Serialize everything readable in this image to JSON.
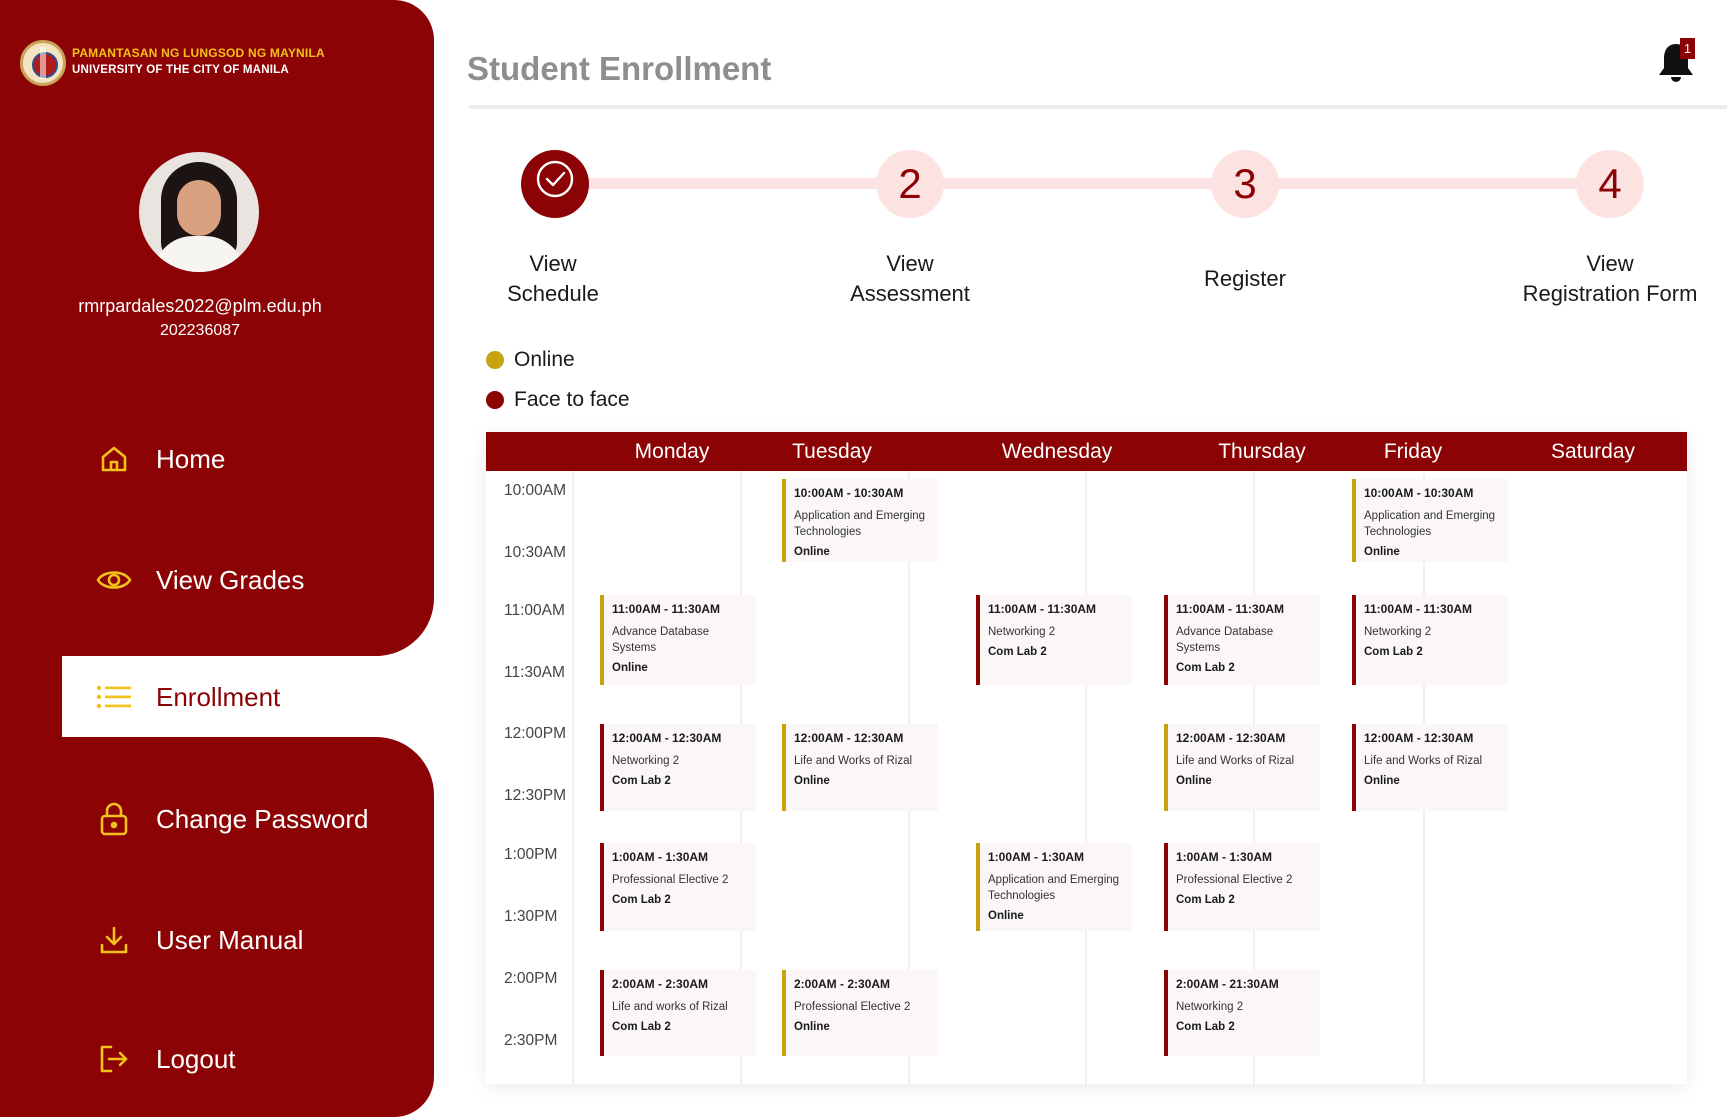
{
  "sidebar": {
    "university_line1": "PAMANTASAN NG LUNGSOD NG MAYNILA",
    "university_line2": "UNIVERSITY OF THE CITY OF MANILA",
    "email": "rmrpardales2022@plm.edu.ph",
    "student_id": "202236087",
    "nav": [
      {
        "label": "Home",
        "icon": "home-icon"
      },
      {
        "label": "View Grades",
        "icon": "eye-icon"
      },
      {
        "label": "Enrollment",
        "icon": "list-icon",
        "active": true
      },
      {
        "label": "Change Password",
        "icon": "lock-icon"
      },
      {
        "label": "User Manual",
        "icon": "download-icon"
      },
      {
        "label": "Logout",
        "icon": "logout-icon"
      }
    ]
  },
  "header": {
    "title": "Student Enrollment",
    "notification_count": "1"
  },
  "stepper": [
    {
      "number": "",
      "label_line1": "View",
      "label_line2": "Schedule",
      "done": true
    },
    {
      "number": "2",
      "label_line1": "View",
      "label_line2": "Assessment"
    },
    {
      "number": "3",
      "label_line1": "Register",
      "label_line2": ""
    },
    {
      "number": "4",
      "label_line1": "View",
      "label_line2": "Registration Form"
    }
  ],
  "legend": [
    {
      "label": "Online",
      "color": "#c9a30f"
    },
    {
      "label": "Face to face",
      "color": "#8b0304"
    }
  ],
  "schedule": {
    "days": [
      "Monday",
      "Tuesday",
      "Wednesday",
      "Thursday",
      "Friday",
      "Saturday"
    ],
    "times": [
      "10:00AM",
      "10:30AM",
      "11:00AM",
      "11:30AM",
      "12:00PM",
      "12:30PM",
      "1:00PM",
      "1:30PM",
      "2:00PM",
      "2:30PM"
    ],
    "classes": [
      {
        "day": 1,
        "time": "10:00AM - 10:30AM",
        "subject": "Application and Emerging Technologies",
        "location": "Online",
        "mode": "online"
      },
      {
        "day": 4,
        "time": "10:00AM - 10:30AM",
        "subject": "Application and Emerging Technologies",
        "location": "Online",
        "mode": "online"
      },
      {
        "day": 0,
        "time": "11:00AM - 11:30AM",
        "subject": "Advance Database Systems",
        "location": "Online",
        "mode": "online"
      },
      {
        "day": 2,
        "time": "11:00AM - 11:30AM",
        "subject": "Networking 2",
        "location": "Com Lab 2",
        "mode": "f2f"
      },
      {
        "day": 3,
        "time": "11:00AM - 11:30AM",
        "subject": "Advance Database Systems",
        "location": "Com Lab 2",
        "mode": "f2f"
      },
      {
        "day": 4,
        "time": "11:00AM - 11:30AM",
        "subject": "Networking 2",
        "location": "Com Lab 2",
        "mode": "f2f"
      },
      {
        "day": 0,
        "time": "12:00AM - 12:30AM",
        "subject": "Networking 2",
        "location": "Com Lab 2",
        "mode": "f2f"
      },
      {
        "day": 1,
        "time": "12:00AM - 12:30AM",
        "subject": "Life and Works of Rizal",
        "location": "Online",
        "mode": "online"
      },
      {
        "day": 3,
        "time": "12:00AM - 12:30AM",
        "subject": "Life and Works of Rizal",
        "location": "Online",
        "mode": "online"
      },
      {
        "day": 4,
        "time": "12:00AM - 12:30AM",
        "subject": "Life and Works of Rizal",
        "location": "Online",
        "mode": "f2f"
      },
      {
        "day": 0,
        "time": "1:00AM - 1:30AM",
        "subject": "Professional Elective 2",
        "location": "Com Lab 2",
        "mode": "f2f"
      },
      {
        "day": 2,
        "time": "1:00AM - 1:30AM",
        "subject": "Application and Emerging Technologies",
        "location": "Online",
        "mode": "online"
      },
      {
        "day": 3,
        "time": "1:00AM - 1:30AM",
        "subject": "Professional Elective 2",
        "location": "Com Lab 2",
        "mode": "f2f"
      },
      {
        "day": 0,
        "time": "2:00AM - 2:30AM",
        "subject": "Life and works of Rizal",
        "location": "Com Lab 2",
        "mode": "f2f"
      },
      {
        "day": 1,
        "time": "2:00AM - 2:30AM",
        "subject": "Professional Elective 2",
        "location": "Online",
        "mode": "online"
      },
      {
        "day": 3,
        "time": "2:00AM - 21:30AM",
        "subject": "Networking 2",
        "location": "Com Lab 2",
        "mode": "f2f"
      }
    ]
  },
  "colors": {
    "primary": "#8b0304",
    "accent_gold": "#f2c21b",
    "online": "#c9a30f"
  }
}
